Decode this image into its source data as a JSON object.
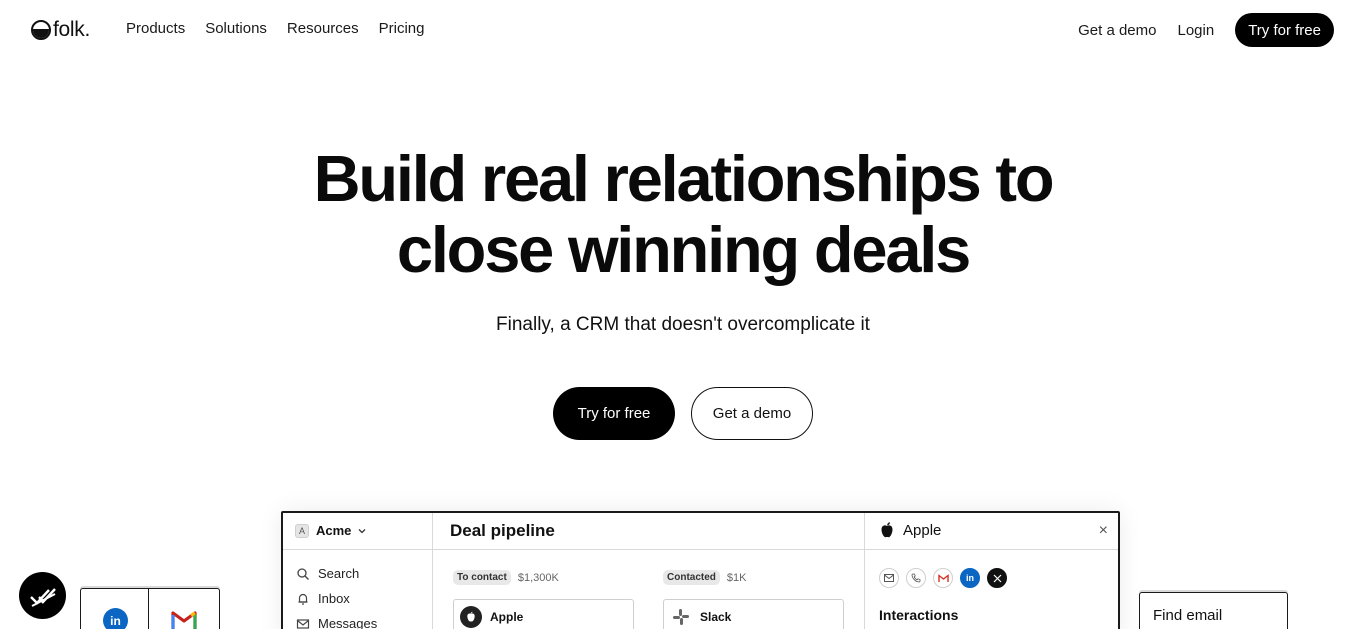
{
  "brand": {
    "name": "folk."
  },
  "nav": {
    "links": [
      "Products",
      "Solutions",
      "Resources",
      "Pricing"
    ],
    "get_demo": "Get a demo",
    "login": "Login",
    "try_free": "Try for free"
  },
  "hero": {
    "title_line1": "Build real relationships to",
    "title_line2": "close winning deals",
    "subtitle": "Finally, a CRM that doesn't overcomplicate it",
    "cta_primary": "Try for free",
    "cta_secondary": "Get a demo"
  },
  "app": {
    "workspace_badge": "A",
    "workspace": "Acme",
    "sidebar": [
      "Search",
      "Inbox",
      "Messages"
    ],
    "main_title": "Deal pipeline",
    "stages": [
      {
        "label": "To contact",
        "amount": "$1,300K",
        "card": "Apple"
      },
      {
        "label": "Contacted",
        "amount": "$1K",
        "card": "Slack"
      }
    ],
    "detail_title": "Apple",
    "detail_section": "Interactions",
    "close_glyph": "×"
  },
  "floating": {
    "apps_li": "in",
    "find_email": "Find email"
  }
}
